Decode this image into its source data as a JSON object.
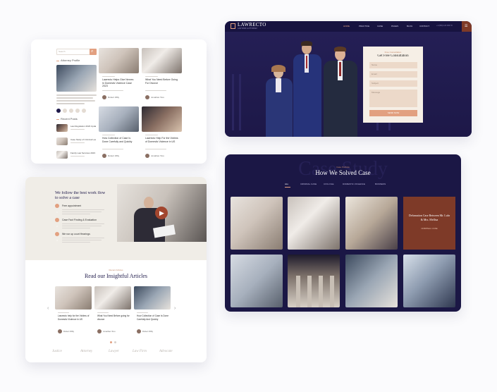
{
  "blog_card": {
    "search_placeholder": "Search",
    "sidebar_title": "Attorney Profile",
    "recent_title": "Recent Posts",
    "posts": [
      {
        "title": "Lawrecto Helps Give Nerves In Domestic Violence Case 2023",
        "author": "Robert Willy"
      },
      {
        "title": "What You Need Before Going For Divorce",
        "author": "Jonathan Toro"
      },
      {
        "title": "How Collection of Case Is Done Carefully and Quickly",
        "author": "Robert Willy"
      },
      {
        "title": "Lawrecto Help For the Victims of Domestic Violence in US",
        "author": "Jonathan Toro"
      }
    ],
    "recent_posts": [
      "Law Regulation 2023 Update",
      "Case Study of Criminal Law",
      "Family Law Services 2023"
    ]
  },
  "hero_card": {
    "brand": "LAWRECTO",
    "brand_tagline": "LAW FIRM & ATTORNEY",
    "nav": [
      "HOME",
      "PRACTICE",
      "CASE",
      "PAGES",
      "BLOG",
      "CONTACT"
    ],
    "phone": "+1 (800) 123 456 78",
    "form_eyebrow": "Free Consultation",
    "form_title": "Get Free Consultation",
    "form_fields": [
      "Name",
      "Email",
      "Subject",
      "Message"
    ],
    "form_button": "SEND NOW"
  },
  "workflow_card": {
    "title_line1": "We follow the best work flow",
    "title_line2": "to solve a case",
    "steps": [
      {
        "num": "1",
        "title": "Free appointment"
      },
      {
        "num": "2",
        "title": "Case Fact Finding & Evaluation"
      },
      {
        "num": "3",
        "title": "We run up court Hearings"
      }
    ],
    "articles_eyebrow": "Recent Articles",
    "articles_title": "Read our Insightful Articles",
    "articles": [
      {
        "title": "Lawrecto help for the Victims of Domestic Violence in US",
        "author": "Robert Willy"
      },
      {
        "title": "What You Need Before going for divorce",
        "author": "Jonathan Toro"
      },
      {
        "title": "How Collection of Case Is Done Carefully And Quickly",
        "author": "Robert Willy"
      }
    ],
    "logos": [
      "Justice",
      "Attorney",
      "Lawyer",
      "Law Firm",
      "Advocate"
    ]
  },
  "cases_card": {
    "bg_word": "Case Study",
    "eyebrow": "Case Portfolio",
    "title": "How We Solved Case",
    "filters": [
      "ALL",
      "CRIMINAL CASE",
      "CIVIL FILE",
      "DOMESTIC VIOLENCE",
      "BUSINESS"
    ],
    "featured_title": "Defamation Case Between Mr. Luhr & Mrs. Mellisa",
    "featured_tag": "CRIMINAL CASE"
  },
  "colors": {
    "navy": "#1f1a4a",
    "navy_dark": "#191542",
    "accent": "#e2a080",
    "rust": "#7e3a28",
    "cream": "#f0ede7"
  }
}
